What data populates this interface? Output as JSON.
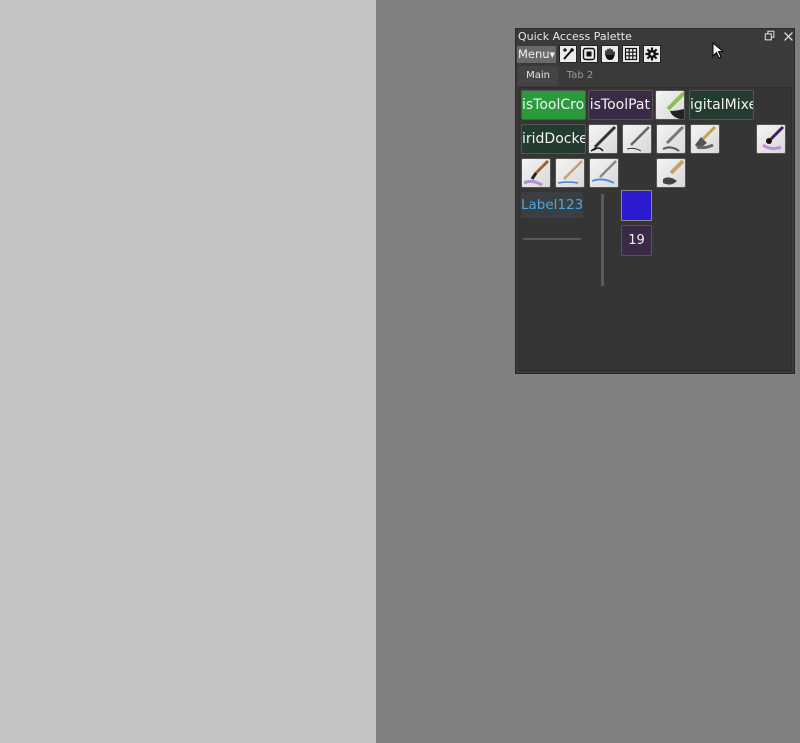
{
  "palette": {
    "title": "Quick Access Palette",
    "menu_label": "Menu",
    "toolbar_icons": [
      "brush-settings-icon",
      "selection-icon",
      "hand-pan-icon",
      "grid-icon",
      "gear-icon"
    ],
    "tabs": [
      {
        "label": "Main",
        "active": true
      },
      {
        "label": "Tab 2",
        "active": false
      }
    ],
    "tiles": {
      "crop": "isToolCro",
      "path": "isToolPat",
      "mixer": "igitalMixe",
      "grid_docker": "iridDocke"
    },
    "label": "Label123",
    "counter": "19",
    "swatch_color": "#2a1ad0"
  },
  "colors": {
    "canvas_left": "#c4c4c4",
    "canvas_right": "#808080",
    "panel_bg": "#3a3a3a",
    "tile_green": "#2a9a3a",
    "tile_purple": "#3a2a45",
    "tile_dark_green": "#243c30",
    "label_blue": "#4fa6dd"
  }
}
